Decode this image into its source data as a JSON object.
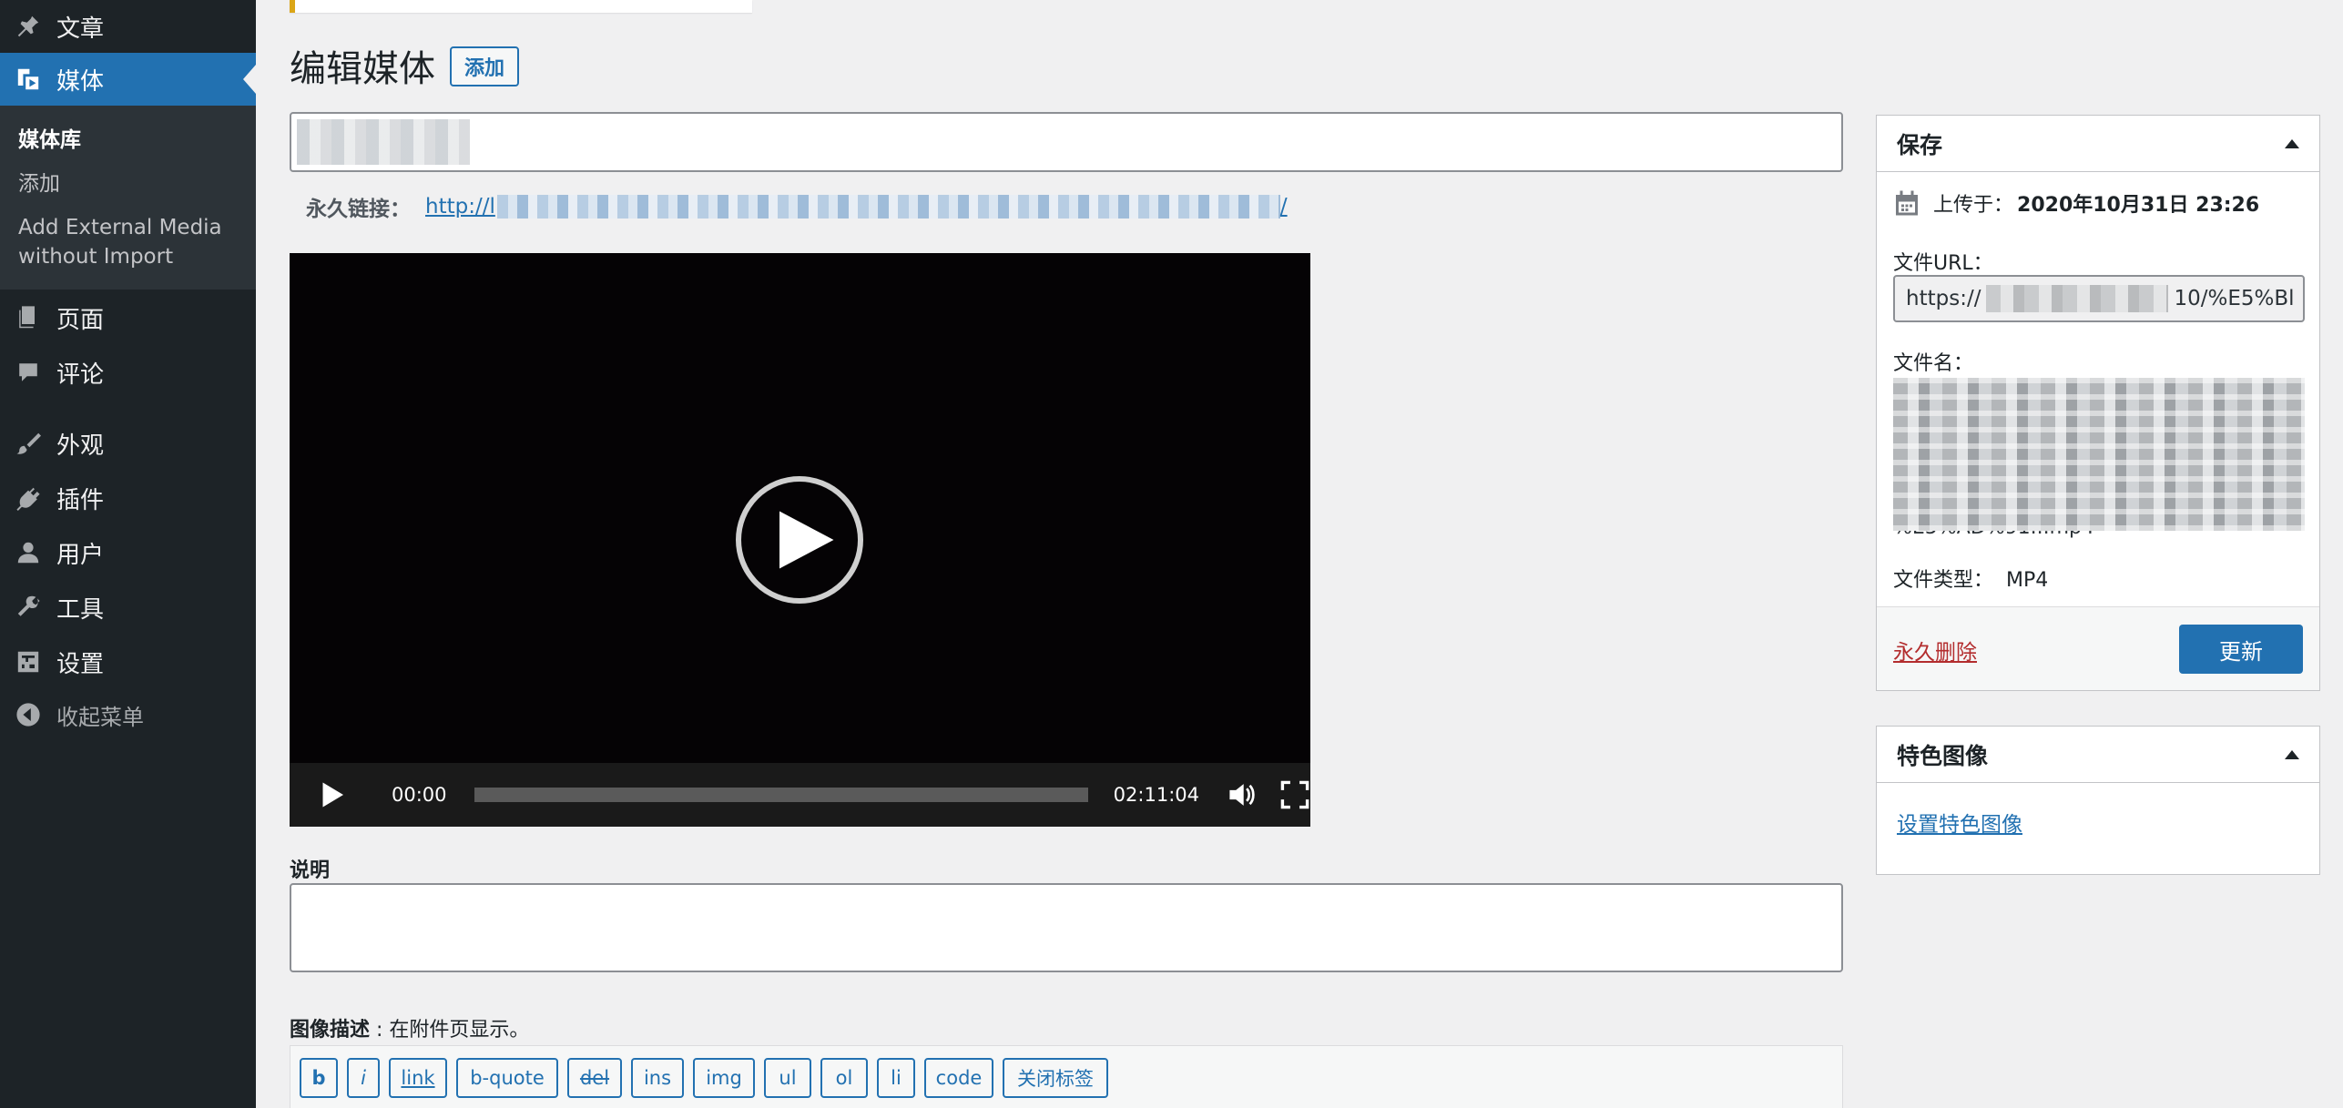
{
  "sidebar": {
    "items": [
      {
        "label": "文章",
        "icon": "pushpin-icon"
      },
      {
        "label": "媒体",
        "icon": "media-icon"
      },
      {
        "label": "页面",
        "icon": "page-icon"
      },
      {
        "label": "评论",
        "icon": "comment-icon"
      },
      {
        "label": "外观",
        "icon": "paintbrush-icon"
      },
      {
        "label": "插件",
        "icon": "plugin-icon"
      },
      {
        "label": "用户",
        "icon": "user-icon"
      },
      {
        "label": "工具",
        "icon": "wrench-icon"
      },
      {
        "label": "设置",
        "icon": "settings-icon"
      }
    ],
    "submenu": {
      "library": "媒体库",
      "add": "添加",
      "external_line1": "Add External Media",
      "external_line2": "without Import"
    },
    "collapse_label": "收起菜单"
  },
  "header": {
    "title": "编辑媒体",
    "add_button": "添加"
  },
  "permalink": {
    "label": "永久链接：",
    "link_prefix": "http://l",
    "link_suffix": "/"
  },
  "video": {
    "current_time": "00:00",
    "duration": "02:11:04",
    "progress": 0
  },
  "caption": {
    "label": "说明"
  },
  "description": {
    "label": "图像描述",
    "note": " : 在附件页显示。"
  },
  "quicktags": [
    "b",
    "i",
    "link",
    "b-quote",
    "del",
    "ins",
    "img",
    "ul",
    "ol",
    "li",
    "code",
    "关闭标签"
  ],
  "save_box": {
    "title": "保存",
    "uploaded_label": "上传于：",
    "uploaded_value": "2020年10月31日 23:26",
    "file_url_label": "文件URL：",
    "file_url_start": "https://",
    "file_url_end": "10/%E5%Bl",
    "file_name_label": "文件名：",
    "file_name_tail": "%E5%AD%91...mp4",
    "file_type_label": "文件类型：",
    "file_type_value": "MP4",
    "delete_link": "永久删除",
    "update_button": "更新"
  },
  "featured_box": {
    "title": "特色图像",
    "set_link": "设置特色图像"
  },
  "colors": {
    "sidebar_bg": "#1d2327",
    "accent": "#2271b1",
    "delete": "#b32d2e"
  }
}
